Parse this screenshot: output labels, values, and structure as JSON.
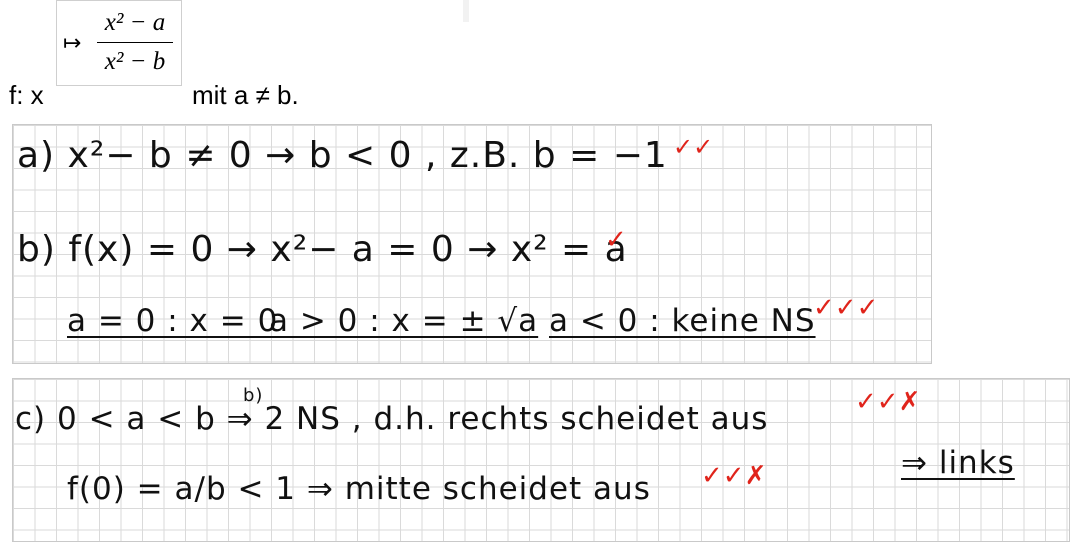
{
  "header": {
    "function_label": "f: x",
    "mapsto_symbol": "↦",
    "numerator": "x² − a",
    "denominator": "x² − b",
    "condition": "mit a ≠ b."
  },
  "part_a": {
    "text": "a) x²− b ≠ 0 → b < 0 , z.B. b = −1",
    "checks": "✓✓"
  },
  "part_b": {
    "line1": "b) f(x) = 0 → x²− a = 0 → x² = a",
    "line1_check": "✓",
    "case1": "a = 0 : x = 0",
    "case2": "a > 0 : x = ± √a",
    "case3": "a < 0 : keine NS",
    "case_checks": "✓✓✓"
  },
  "part_c": {
    "line1": "c) 0 < a < b ⇒ 2 NS , d.h. rechts scheidet aus",
    "line1_ref": "b)",
    "line1_checks": "✓✓✗",
    "line2": "f(0) = a/b < 1 ⇒ mitte scheidet aus",
    "line2_checks": "✓✓✗",
    "conclusion": "⇒ links"
  }
}
